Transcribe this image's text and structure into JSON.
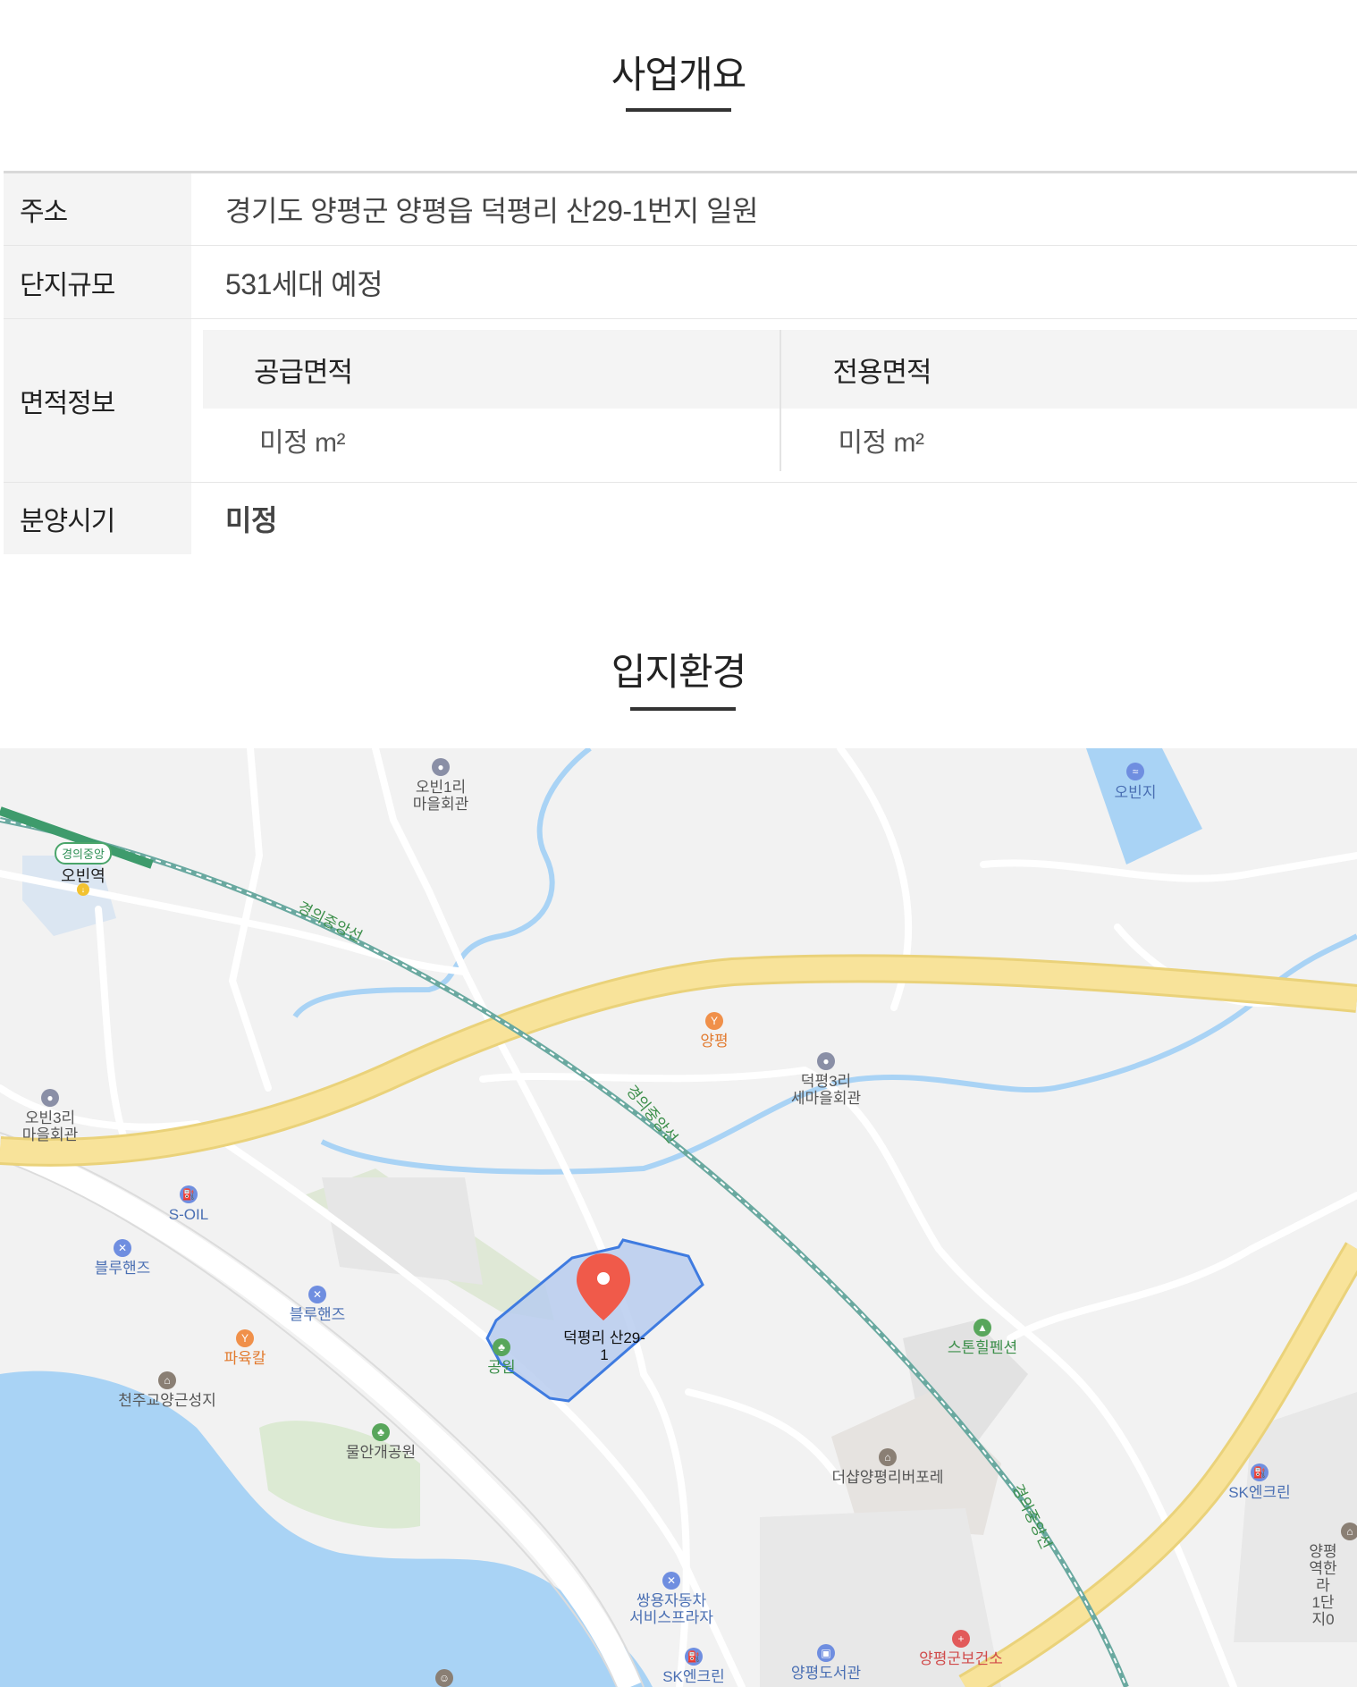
{
  "overview": {
    "title": "사업개요",
    "rows": {
      "address": {
        "label": "주소",
        "value": "경기도 양평군 양평읍 덕평리 산29-1번지 일원"
      },
      "scale": {
        "label": "단지규모",
        "value": "531세대 예정"
      },
      "area": {
        "label": "면적정보",
        "supply_label": "공급면적",
        "supply_value": "미정 m²",
        "exclusive_label": "전용면적",
        "exclusive_value": "미정 m²"
      },
      "sale": {
        "label": "분양시기",
        "value": "미정"
      }
    }
  },
  "location": {
    "title": "입지환경",
    "marker_label": "덕평리 산29-\n1",
    "labels": {
      "obin1": "오빈1리\n마을회관",
      "obinji": "오빈지",
      "line_badge": "경의중앙",
      "obin_station": "오빈역",
      "line1": "경의중앙선",
      "line2": "경의중앙선",
      "line3": "경의중앙선",
      "yangpyeong": "양평",
      "deokpyeong3": "덕평3리\n세마을회관",
      "obin3": "오빈3리\n마을회관",
      "soil": "S-OIL",
      "bluehands1": "블루핸즈",
      "bluehands2": "블루핸즈",
      "payukkal": "파육칼",
      "park": "공원",
      "stonehill": "스톤힐펜션",
      "catholic": "천주교양근성지",
      "mulangae": "물안개공원",
      "theshop": "더샵양평리버포레",
      "sk1": "SK엔크린",
      "yp_hanra": "양평역한라\n1단지0",
      "ssangyong": "쌍용자동차\n서비스프라자",
      "library": "양평도서관",
      "health": "양평군보건소",
      "sk2": "SK엔크린"
    },
    "colors": {
      "water": "#a9d3f5",
      "road_main": "#f8e39a",
      "road_edge": "#ead27a",
      "area_fill": "#b9cdee",
      "area_stroke": "#3f7be0",
      "marker": "#f05a4a",
      "rail": "#6aa9a0"
    }
  }
}
